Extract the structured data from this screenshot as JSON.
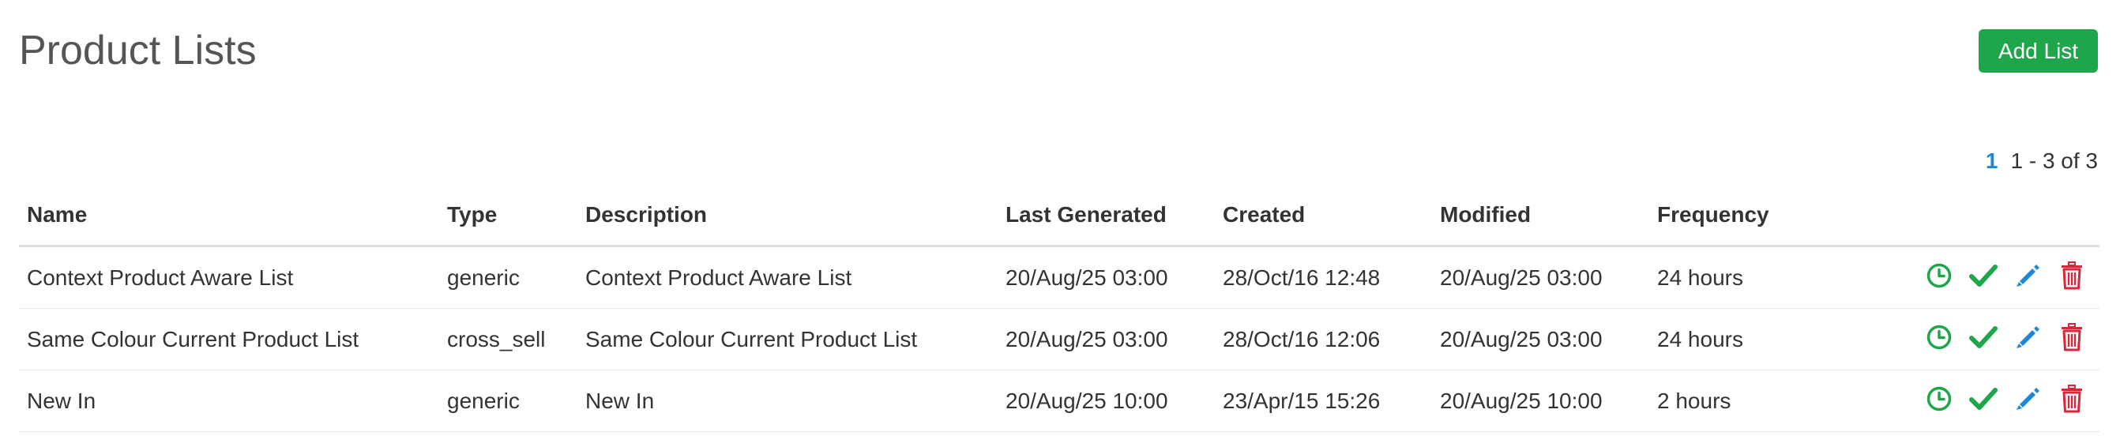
{
  "header": {
    "title": "Product Lists",
    "add_button_label": "Add List"
  },
  "pagination": {
    "current_page": "1",
    "range_text": "1 - 3 of 3"
  },
  "table": {
    "columns": [
      "Name",
      "Type",
      "Description",
      "Last Generated",
      "Created",
      "Modified",
      "Frequency"
    ],
    "rows": [
      {
        "name": "Context Product Aware List",
        "type": "generic",
        "description": "Context Product Aware List",
        "last_generated": "20/Aug/25 03:00",
        "created": "28/Oct/16 12:48",
        "modified": "20/Aug/25 03:00",
        "frequency": "24 hours"
      },
      {
        "name": "Same Colour Current Product List",
        "type": "cross_sell",
        "description": "Same Colour Current Product List",
        "last_generated": "20/Aug/25 03:00",
        "created": "28/Oct/16 12:06",
        "modified": "20/Aug/25 03:00",
        "frequency": "24 hours"
      },
      {
        "name": "New In",
        "type": "generic",
        "description": "New In",
        "last_generated": "20/Aug/25 10:00",
        "created": "23/Apr/15 15:26",
        "modified": "20/Aug/25 10:00",
        "frequency": "2 hours"
      }
    ],
    "row_actions": [
      "clock-icon",
      "check-icon",
      "pencil-icon",
      "trash-icon"
    ]
  },
  "colors": {
    "accent_green": "#1fa64a",
    "link_blue": "#1e88d6",
    "delete_red": "#d9263b",
    "text": "#333333"
  }
}
